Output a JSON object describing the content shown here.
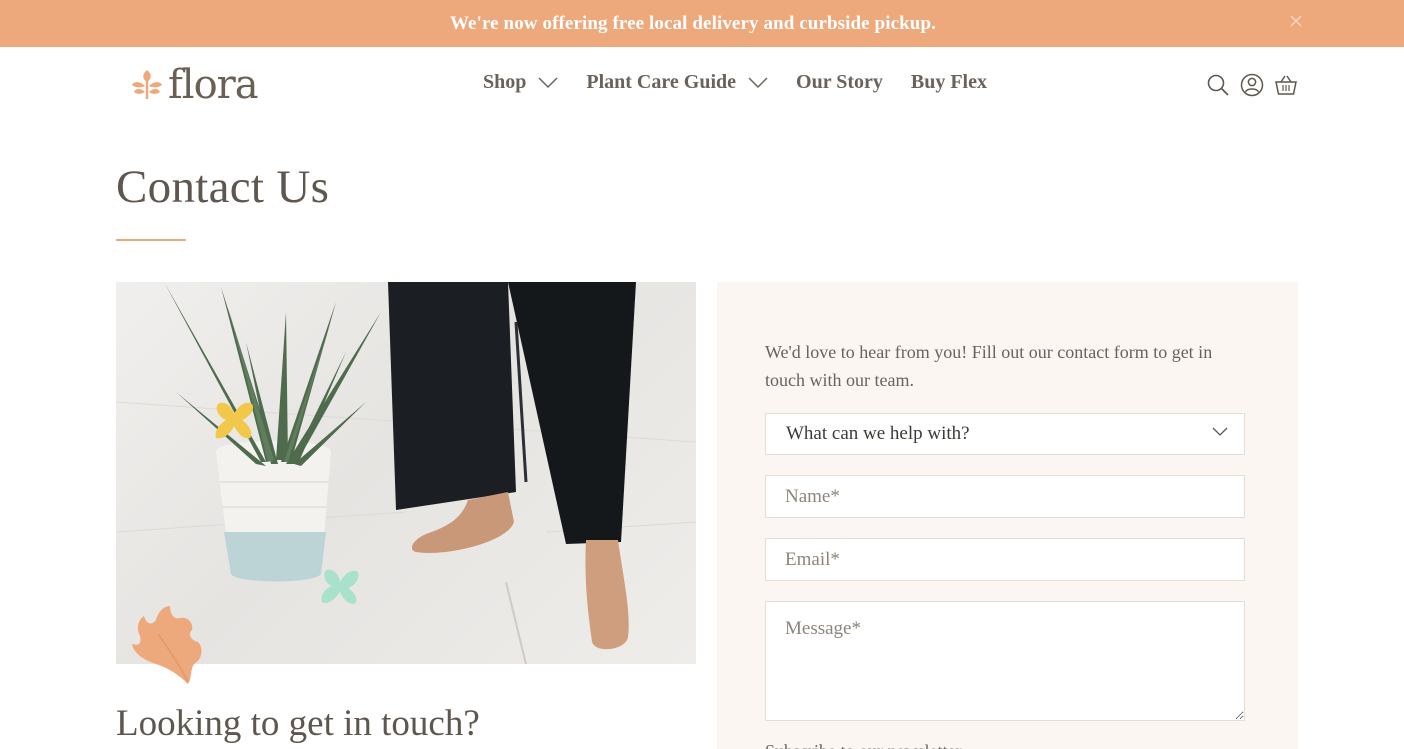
{
  "announcement": {
    "text": "We're now offering free local delivery and curbside pickup.",
    "close_icon": "close-icon"
  },
  "header": {
    "logo_text": "flora",
    "logo_icon": "leaf-icon",
    "nav": [
      {
        "label": "Shop",
        "has_dropdown": true
      },
      {
        "label": "Plant Care Guide",
        "has_dropdown": true
      },
      {
        "label": "Our Story",
        "has_dropdown": false
      },
      {
        "label": "Buy Flex",
        "has_dropdown": false
      }
    ],
    "icons": [
      "search-icon",
      "account-icon",
      "cart-icon"
    ]
  },
  "page": {
    "title": "Contact Us",
    "section_heading": "Looking to get in touch?"
  },
  "contact_form": {
    "intro": "We'd love to hear from you! Fill out our contact form to get in touch with our team.",
    "topic_select": "What can we help with?",
    "name_placeholder": "Name*",
    "email_placeholder": "Email*",
    "message_placeholder": "Message*",
    "footer_text": "Subscribe to our newsletter"
  },
  "colors": {
    "accent": "#eda87c",
    "panel_bg": "#fbf6f1",
    "text": "#5e5750"
  }
}
